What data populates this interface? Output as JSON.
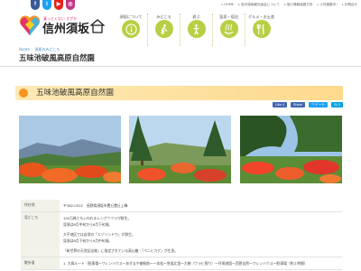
{
  "social": [
    {
      "icon": "f",
      "color": "#3b5998"
    },
    {
      "icon": "t",
      "color": "#1da1f2"
    },
    {
      "icon": "▶",
      "color": "#e62117"
    },
    {
      "icon": "◎",
      "color": "#c13584"
    }
  ],
  "top_links": [
    "HOME",
    "信州須坂観光協会について",
    "個人情報保護方針",
    "人材募集中!",
    "お問合せ"
  ],
  "logo": {
    "catch": "乗っとくない すざか",
    "name": "信州須坂"
  },
  "nav": [
    {
      "label": "須坂について",
      "icon": "info-icon"
    },
    {
      "label": "みどころ",
      "icon": "hiking-icon"
    },
    {
      "label": "遊ぶ",
      "icon": "play-icon"
    },
    {
      "label": "温泉・宿泊",
      "icon": "onsen-icon"
    },
    {
      "label": "グルメ・お土産",
      "icon": "gourmet-icon"
    }
  ],
  "breadcrumb": {
    "home": "Home",
    "current": "須坂のみどころ"
  },
  "page_title": "五味池破風高原自然園",
  "section_title": "五味池破風高原自然園",
  "share": {
    "like": "Like 4",
    "share": "Share",
    "tweet": "ツイート",
    "bookmark": "B! 0"
  },
  "colors": {
    "accent": "#f6921e",
    "nav_circle": "#b8cf45",
    "band": "#fdd98c"
  },
  "info": [
    {
      "label": "所在地",
      "lines": [
        "〒382-0022　長野県須坂市豊丘豊丘上峰"
      ]
    },
    {
      "label": "見どころ",
      "lines": [
        "100万株ともいわれるレンゲツツジが群生。",
        "見頃は6月中旬から6月下旬頃。",
        "",
        "大平地区では自然の「エゾリンドウ」が群生。",
        "見頃は8月下旬から9月中旬頃。",
        "",
        "「新世界の天然記念物」に指定されている高山植・「ペニヒカゲ」が生息。"
      ]
    },
    {
      "label": "散歩道",
      "lines": [
        "1. 大鳥ルート（駐車場〜ワレンハウス〜あずまや着駅前〜一本松〜急坂北里〜大樹（ワラビ探り）〜丹塚遊園〜西菅自然〜ワレンハウス〜駐車場（約２時間）"
      ]
    }
  ]
}
